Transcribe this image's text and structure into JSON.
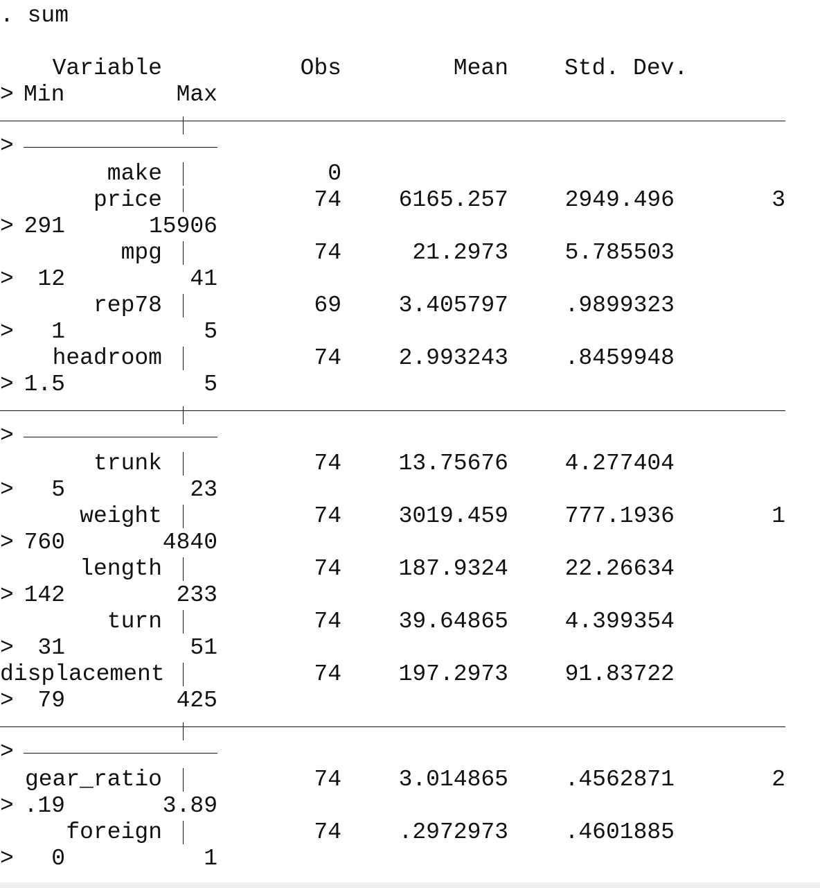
{
  "command": ". sum",
  "continuation_marker": ">",
  "headers": {
    "variable": "Variable",
    "obs": "Obs",
    "mean": "Mean",
    "std_dev": "Std. Dev.",
    "min": "Min",
    "max": "Max"
  },
  "rows": [
    {
      "variable": "make",
      "obs": "0",
      "mean": "",
      "std": "",
      "min_tail": "",
      "min": "",
      "max": ""
    },
    {
      "variable": "price",
      "obs": "74",
      "mean": "6165.257",
      "std": "2949.496",
      "min_tail": "3",
      "min": "291",
      "max": "15906"
    },
    {
      "variable": "mpg",
      "obs": "74",
      "mean": "21.2973",
      "std": "5.785503",
      "min_tail": "",
      "min": "12",
      "max": "41"
    },
    {
      "variable": "rep78",
      "obs": "69",
      "mean": "3.405797",
      "std": ".9899323",
      "min_tail": "",
      "min": "1",
      "max": "5"
    },
    {
      "variable": "headroom",
      "obs": "74",
      "mean": "2.993243",
      "std": ".8459948",
      "min_tail": "",
      "min": "1.5",
      "max": "5"
    },
    {
      "variable": "trunk",
      "obs": "74",
      "mean": "13.75676",
      "std": "4.277404",
      "min_tail": "",
      "min": "5",
      "max": "23"
    },
    {
      "variable": "weight",
      "obs": "74",
      "mean": "3019.459",
      "std": "777.1936",
      "min_tail": "1",
      "min": "760",
      "max": "4840"
    },
    {
      "variable": "length",
      "obs": "74",
      "mean": "187.9324",
      "std": "22.26634",
      "min_tail": "",
      "min": "142",
      "max": "233"
    },
    {
      "variable": "turn",
      "obs": "74",
      "mean": "39.64865",
      "std": "4.399354",
      "min_tail": "",
      "min": "31",
      "max": "51"
    },
    {
      "variable": "displacement",
      "obs": "74",
      "mean": "197.2973",
      "std": "91.83722",
      "min_tail": "",
      "min": "79",
      "max": "425"
    },
    {
      "variable": "gear_ratio",
      "obs": "74",
      "mean": "3.014865",
      "std": ".4562871",
      "min_tail": "2",
      "min": ".19",
      "max": "3.89"
    },
    {
      "variable": "foreign",
      "obs": "74",
      "mean": ".2972973",
      "std": ".4601885",
      "min_tail": "",
      "min": "0",
      "max": "1"
    }
  ],
  "colors": {
    "text": "#111111",
    "background": "#ffffff"
  }
}
